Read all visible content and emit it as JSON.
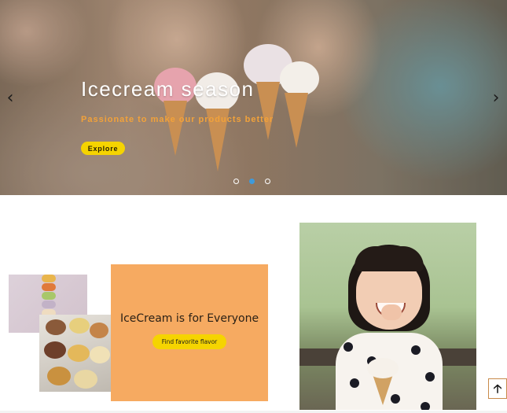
{
  "hero": {
    "title": "Icecream season",
    "subtitle": "Passionate to make our products better",
    "explore_label": "Explore",
    "prev_arrow": "‹",
    "next_arrow": "›",
    "slide_count": 3,
    "active_slide": 2,
    "icons": {
      "prev": "chevron-left-icon",
      "next": "chevron-right-icon"
    }
  },
  "promo": {
    "title": "IceCream is for Everyone",
    "button_label": "Find favorite flavor"
  },
  "scroll_top": {
    "glyph": "🡡",
    "icon": "arrow-up-icon"
  },
  "colors": {
    "promo_background": "#f6aa61",
    "button_yellow": "#f5d400",
    "hero_subtitle": "#f2a23a",
    "active_dot": "#3e9adb"
  }
}
